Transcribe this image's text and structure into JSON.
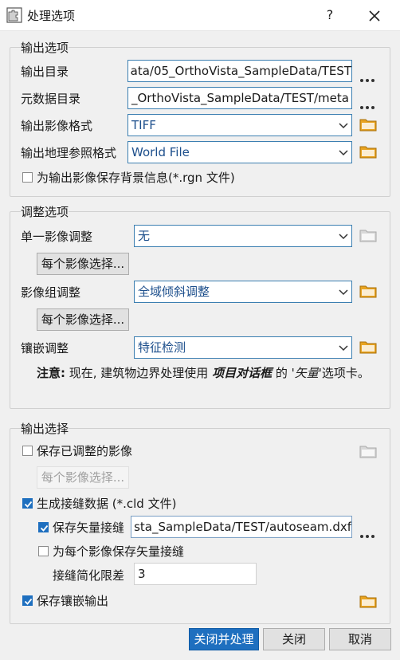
{
  "window": {
    "title": "处理选项",
    "help": "?"
  },
  "output_options": {
    "title": "输出选项",
    "dir_label": "输出目录",
    "dir_value": "ata/05_OrthoVista_SampleData/TEST",
    "meta_label": "元数据目录",
    "meta_value": "_OrthoVista_SampleData/TEST/meta",
    "format_label": "输出影像格式",
    "format_value": "TIFF",
    "georef_label": "输出地理参照格式",
    "georef_value": "World File",
    "rgn_label": "为输出影像保存背景信息(*.rgn 文件)",
    "rgn_checked": false
  },
  "adjust_options": {
    "title": "调整选项",
    "single_label": "单一影像调整",
    "single_value": "无",
    "per_image_button": "每个影像选择...",
    "group_label": "影像组调整",
    "group_value": "全域倾斜调整",
    "per_image_button2": "每个影像选择...",
    "mosaic_label": "镶嵌调整",
    "mosaic_value": "特征检测",
    "note_bold": "注意:",
    "note_text1": " 现在, 建筑物边界处理使用 ",
    "note_em": "项目对话框",
    "note_text2": " 的 '",
    "note_em2": "矢量",
    "note_text3": "'选项卡。"
  },
  "output_select": {
    "title": "输出选择",
    "save_adjusted_label": "保存已调整的影像",
    "save_adjusted_checked": false,
    "per_image_button": "每个影像选择...",
    "seam_label": "生成接缝数据 (*.cld 文件)",
    "seam_checked": true,
    "save_vector_label": "保存矢量接缝",
    "save_vector_checked": true,
    "vector_path": "sta_SampleData/TEST/autoseam.dxf",
    "per_image_vector_label": "为每个影像保存矢量接缝",
    "per_image_vector_checked": false,
    "simplify_label": "接缝简化限差",
    "simplify_value": "3",
    "save_mosaic_label": "保存镶嵌输出",
    "save_mosaic_checked": true
  },
  "buttons": {
    "close_process": "关闭并处理",
    "close": "关闭",
    "cancel": "取消"
  },
  "colors": {
    "accent": "#1e6fbf",
    "folder": "#e8a320"
  }
}
